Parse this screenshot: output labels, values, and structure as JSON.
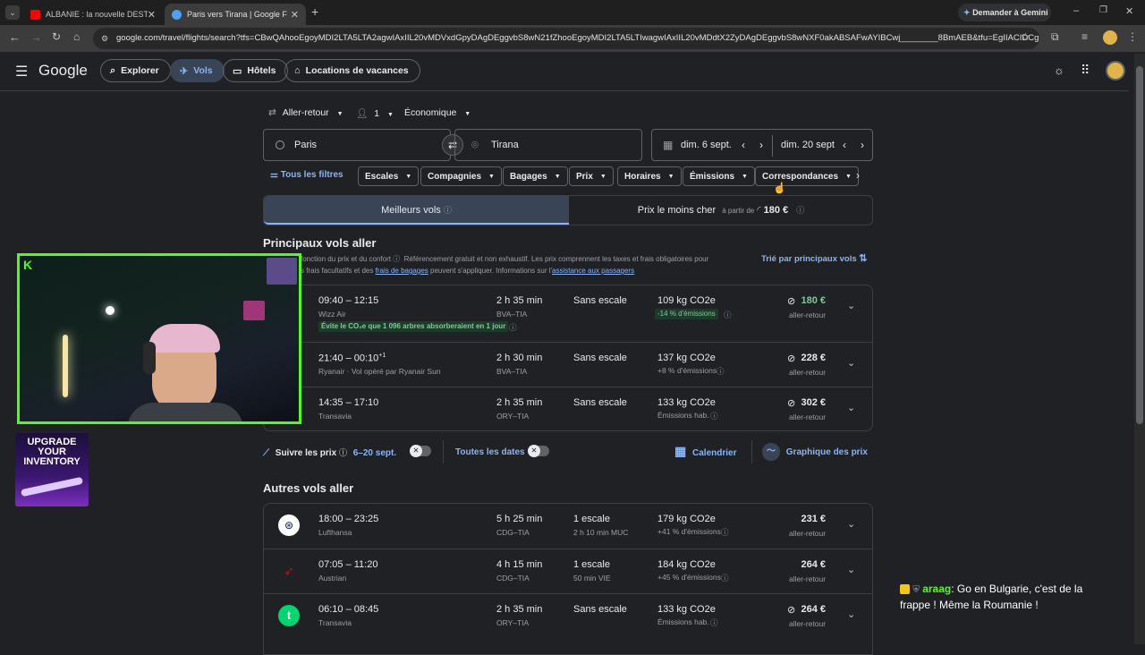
{
  "browser": {
    "tabs": [
      {
        "label": "ALBANIE : la nouvelle DESTINAT",
        "active": false
      },
      {
        "label": "Paris vers Tirana | Google Flight",
        "active": true
      }
    ],
    "new_tab": "+",
    "gemini": "Demander à Gemini",
    "url": "google.com/travel/flights/search?tfs=CBwQAhooEgoyMDI2LTA5LTA2agwIAxIIL20vMDVxdGpyDAgDEggvbS8wN21fZhooEgoyMDI2LTA5LTIwagwIAxIIL20vMDdtX2ZyDAgDEggvbS8wNXF0akABSAFwAYIBCwj________8BmAEB&tfu=EgIIACIDCgEw..."
  },
  "google": {
    "logo": "Google",
    "nav": [
      "Explorer",
      "Vols",
      "Hôtels",
      "Locations de vacances"
    ]
  },
  "search": {
    "trip_type": "Aller-retour",
    "passengers": "1",
    "cabin": "Économique",
    "origin": "Paris",
    "destination": "Tirana",
    "depart": "dim. 6 sept.",
    "return": "dim. 20 sept",
    "filters": [
      "Tous les filtres",
      "Escales",
      "Compagnies",
      "Bagages",
      "Prix",
      "Horaires",
      "Émissions",
      "Correspondances"
    ]
  },
  "sort_tabs": {
    "best": "Meilleurs vols",
    "cheapest": "Prix le moins cher",
    "from_label": "à partir de",
    "from_price": "180 €"
  },
  "main": {
    "title": "Principaux vols aller",
    "disclaimer_1": "fonction du prix et du confort",
    "disclaimer_2": "Référencement gratuit et non exhaustif. Les prix comprennent les taxes et frais obligatoires pour",
    "disclaimer_3": "s frais facultatifs et des",
    "disclaimer_link": "frais de bagages",
    "disclaimer_4": "peuvent s'appliquer. Informations sur l'",
    "disclaimer_link2": "assistance aux passagers",
    "sort": "Trié par principaux vols",
    "flights": [
      {
        "time": "09:40 – 12:15",
        "sup": "",
        "airline": "Wizz Air",
        "duration": "2 h 35 min",
        "route": "BVA–TIA",
        "stops": "Sans escale",
        "stop_detail": "",
        "co2": "109 kg CO2e",
        "emis": "-14 % d'émissions",
        "price": "180 €",
        "price_note": "aller-retour",
        "badge": "Évite le CO₂e que 1 096 arbres absorberaient en 1 jour"
      },
      {
        "time": "21:40 – 00:10",
        "sup": "+1",
        "airline": "Ryanair · Vol opéré par Ryanair Sun",
        "duration": "2 h 30 min",
        "route": "BVA–TIA",
        "stops": "Sans escale",
        "stop_detail": "",
        "co2": "137 kg CO2e",
        "emis": "+8 % d'émissions",
        "price": "228 €",
        "price_note": "aller-retour",
        "badge": ""
      },
      {
        "time": "14:35 – 17:10",
        "sup": "",
        "airline": "Transavia",
        "duration": "2 h 35 min",
        "route": "ORY–TIA",
        "stops": "Sans escale",
        "stop_detail": "",
        "co2": "133 kg CO2e",
        "emis": "Émissions hab.",
        "price": "302 €",
        "price_note": "aller-retour",
        "badge": ""
      }
    ]
  },
  "tracking": {
    "follow": "Suivre les prix",
    "dates": "6–20 sept.",
    "all_dates": "Toutes les dates",
    "calendar": "Calendrier",
    "graph": "Graphique des prix"
  },
  "other": {
    "title": "Autres vols aller",
    "flights": [
      {
        "time": "18:00 – 23:25",
        "airline": "Lufthansa",
        "duration": "5 h 25 min",
        "route": "CDG–TIA",
        "stops": "1 escale",
        "stop_detail": "2 h 10 min MUC",
        "co2": "179 kg CO2e",
        "emis": "+41 % d'émissions",
        "price": "231 €",
        "price_note": "aller-retour"
      },
      {
        "time": "07:05 – 11:20",
        "airline": "Austrian",
        "duration": "4 h 15 min",
        "route": "CDG–TIA",
        "stops": "1 escale",
        "stop_detail": "50 min VIE",
        "co2": "184 kg CO2e",
        "emis": "+45 % d'émissions",
        "price": "264 €",
        "price_note": "aller-retour"
      },
      {
        "time": "06:10 – 08:45",
        "airline": "Transavia",
        "duration": "2 h 35 min",
        "route": "ORY–TIA",
        "stops": "Sans escale",
        "stop_detail": "",
        "co2": "133 kg CO2e",
        "emis": "Émissions hab.",
        "price": "264 €",
        "price_note": "aller-retour"
      }
    ]
  },
  "overlay": {
    "upgrade": "UPGRADE YOUR INVENTORY",
    "chat_user": "araag",
    "chat_msg": ": Go en Bulgarie, c'est de la frappe ! Même la Roumanie !"
  },
  "colors": {
    "accent": "#8ab4f8",
    "green": "#81c995",
    "kick": "#53fc18"
  }
}
